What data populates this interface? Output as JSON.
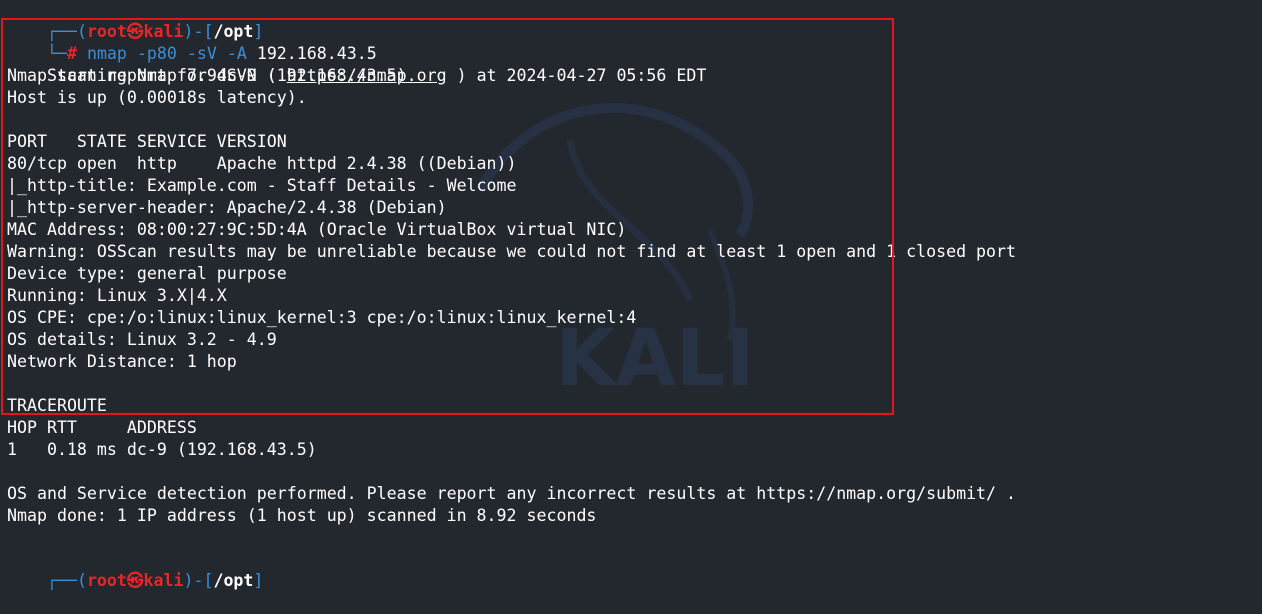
{
  "prompt1": {
    "corner": "┌──(",
    "user": "root㉿kali",
    "mid": ")-[",
    "path": "/opt",
    "end": "]"
  },
  "command": {
    "corner": "└─",
    "hash": "#",
    "name": "nmap",
    "flags": "-p80 -sV -A",
    "target": "192.168.43.5"
  },
  "output": {
    "start_prefix": "Starting Nmap 7.94SVN ( ",
    "start_url": "https://nmap.org",
    "start_suffix": " ) at 2024-04-27 05:56 EDT",
    "line_report": "Nmap scan report for dc-9 (192.168.43.5)",
    "line_hostup": "Host is up (0.00018s latency).",
    "line_header": "PORT   STATE SERVICE VERSION",
    "line_port": "80/tcp open  http    Apache httpd 2.4.38 ((Debian))",
    "line_title": "|_http-title: Example.com - Staff Details - Welcome",
    "line_server": "|_http-server-header: Apache/2.4.38 (Debian)",
    "line_mac": "MAC Address: 08:00:27:9C:5D:4A (Oracle VirtualBox virtual NIC)",
    "line_warning": "Warning: OSScan results may be unreliable because we could not find at least 1 open and 1 closed port",
    "line_device": "Device type: general purpose",
    "line_running": "Running: Linux 3.X|4.X",
    "line_cpe": "OS CPE: cpe:/o:linux:linux_kernel:3 cpe:/o:linux:linux_kernel:4",
    "line_details": "OS details: Linux 3.2 - 4.9",
    "line_distance": "Network Distance: 1 hop",
    "line_traceroute": "TRACEROUTE",
    "line_hop_header": "HOP RTT     ADDRESS",
    "line_hop1": "1   0.18 ms dc-9 (192.168.43.5)",
    "line_osdetect": "OS and Service detection performed. Please report any incorrect results at https://nmap.org/submit/ .",
    "line_done": "Nmap done: 1 IP address (1 host up) scanned in 8.92 seconds"
  },
  "prompt2": {
    "corner": "┌──(",
    "user": "root㉿kali",
    "mid": ")-[",
    "path": "/opt",
    "end": "]"
  },
  "watermark_text": "KALI",
  "colors": {
    "background": "#23272e",
    "prompt_blue": "#3a8fd9",
    "prompt_red": "#e8262a",
    "highlight_border": "#e8141c"
  }
}
